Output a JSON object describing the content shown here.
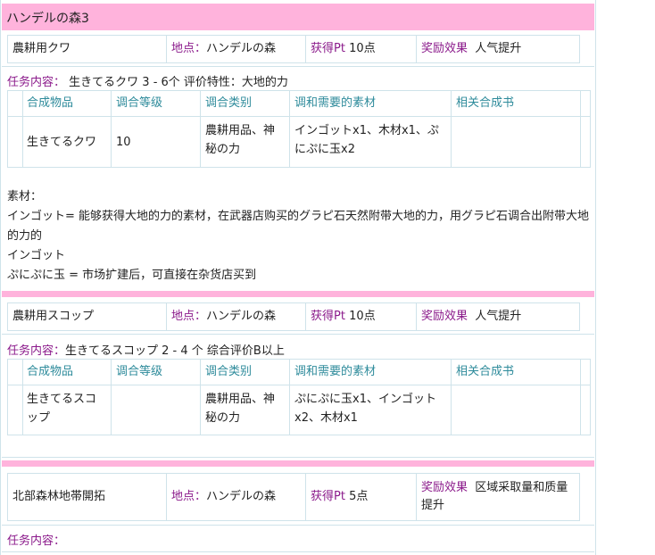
{
  "section_title": "ハンデルの森3",
  "labels": {
    "location": "地点：",
    "reward_pt": "获得Pt",
    "bonus": "奖励效果",
    "task": "任务内容："
  },
  "table_headers": [
    "合成物品",
    "调合等级",
    "调合类别",
    "调和需要的素材",
    "相关合成书"
  ],
  "tasks": [
    {
      "name": "農耕用クワ",
      "location": "ハンデルの森",
      "pt": "10点",
      "bonus": "人气提升",
      "content": "生きてるクワ 3 - 6个 评价特性：大地的力",
      "row": {
        "item": "生きてるクワ",
        "level": "10",
        "category": "農耕用品、神秘の力",
        "materials": "インゴットx1、木材x1、ぷにぷに玉x2",
        "book": ""
      }
    },
    {
      "name": "農耕用スコップ",
      "location": "ハンデルの森",
      "pt": "10点",
      "bonus": "人气提升",
      "content": "生きてるスコップ   2 - 4 个 综合评价B以上",
      "row": {
        "item": "生きてるスコップ",
        "level": "",
        "category": "農耕用品、神秘の力",
        "materials": "ぷにぷに玉x1、インゴットx2、木材x1",
        "book": ""
      }
    },
    {
      "name": "北部森林地帯開拓",
      "location": "ハンデルの森",
      "pt": "5点",
      "bonus": "区域采取量和质量提升",
      "content": ""
    }
  ],
  "materials_note": {
    "heading": "素材：",
    "line1": "インゴット= 能够获得大地的力的素材，在武器店购买的グラピ石天然附带大地的力，用グラピ石调合出附带大地的力的",
    "line2": "インゴット",
    "line3": "ぷにぷに玉 = 市场扩建后，可直接在杂货店买到"
  }
}
